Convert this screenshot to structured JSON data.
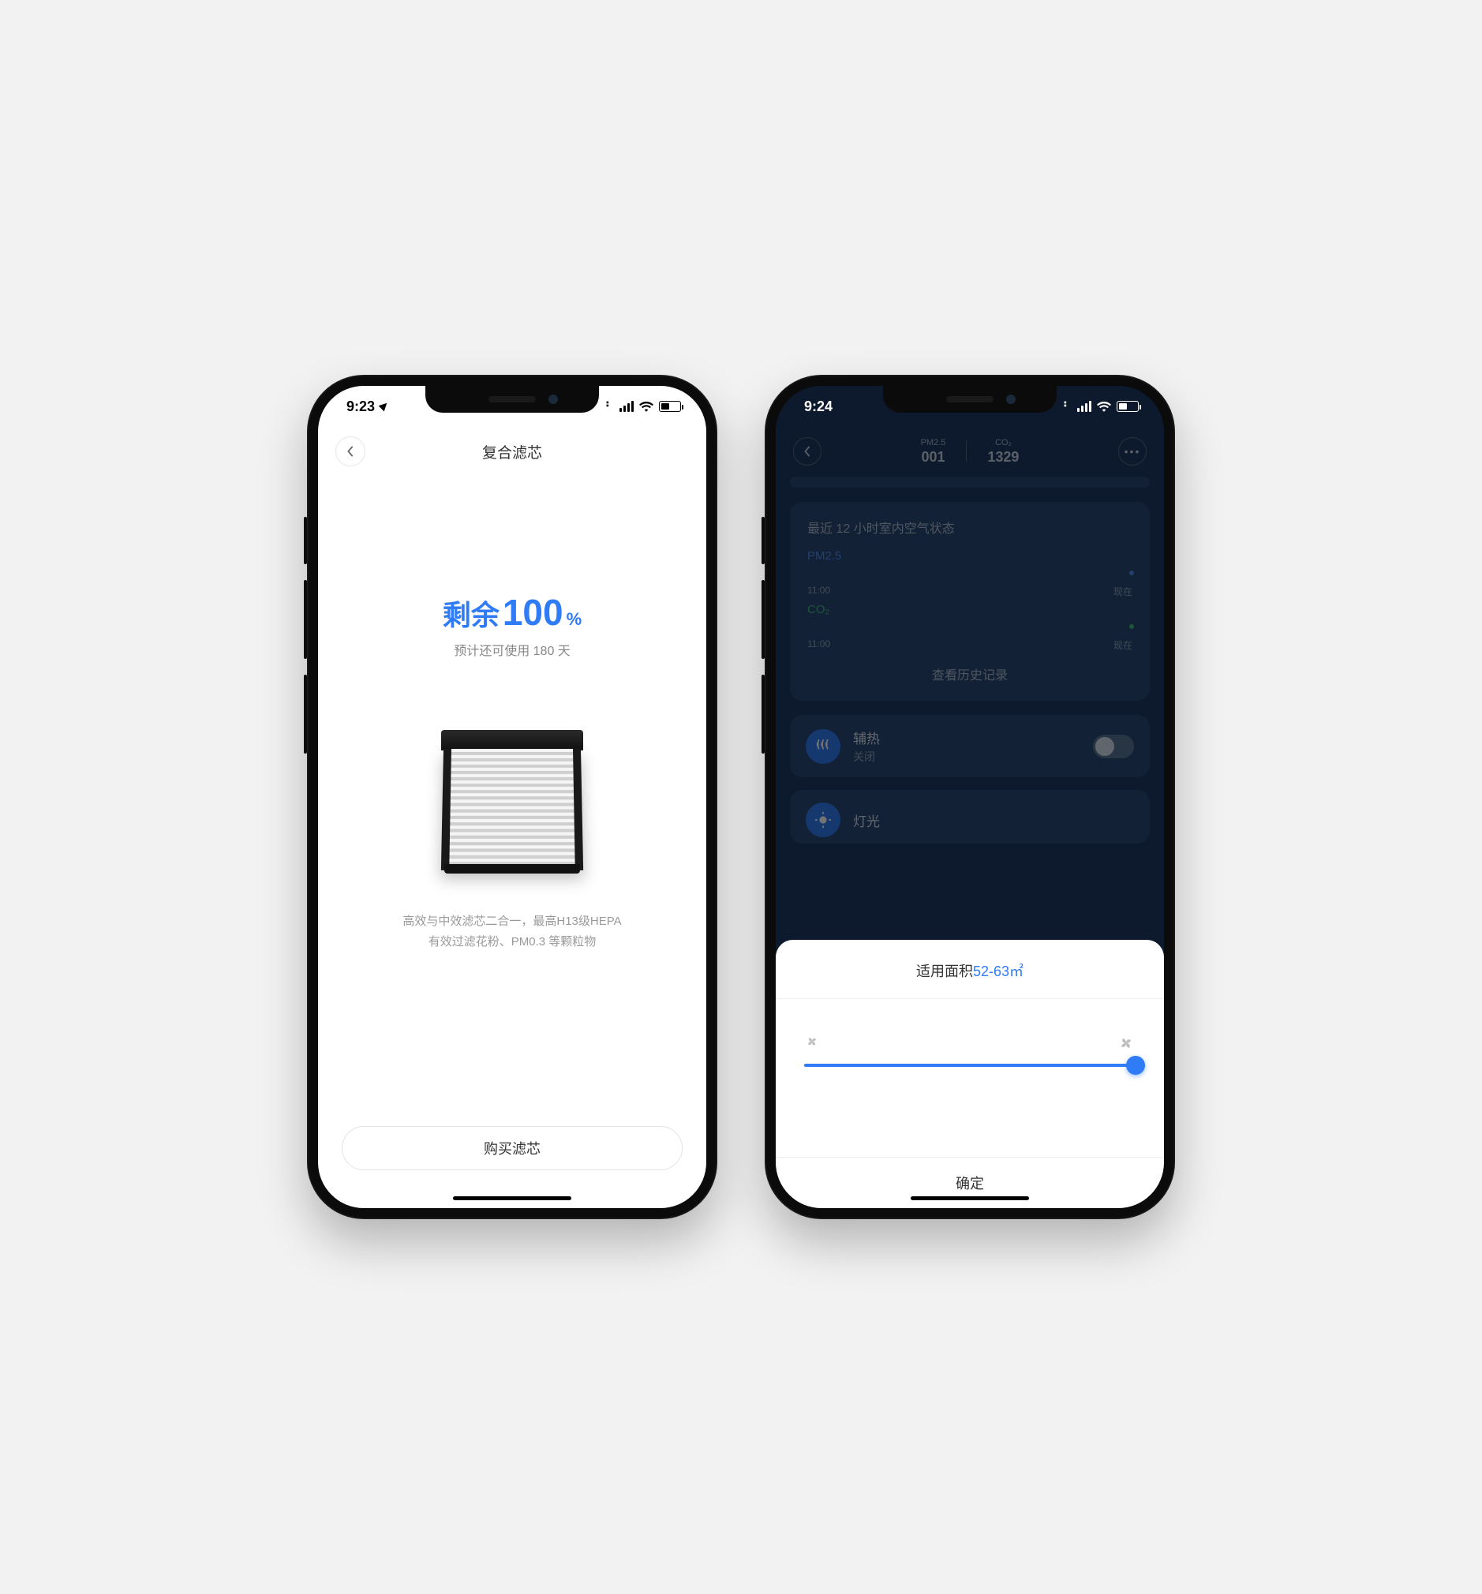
{
  "left": {
    "status": {
      "time": "9:23"
    },
    "header": {
      "title": "复合滤芯"
    },
    "remaining": {
      "label": "剩余",
      "value": "100",
      "percent_symbol": "%",
      "subtitle": "预计还可使用 180 天"
    },
    "desc": {
      "line1": "高效与中效滤芯二合一，最高H13级HEPA",
      "line2": "有效过滤花粉、PM0.3 等颗粒物"
    },
    "buy_button": "购买滤芯"
  },
  "right": {
    "status": {
      "time": "9:24"
    },
    "metrics": {
      "pm25_label": "PM2.5",
      "pm25_value": "001",
      "co2_label": "CO₂",
      "co2_value": "1329"
    },
    "card": {
      "title": "最近 12 小时室内空气状态",
      "series1_label": "PM2.5",
      "series2_label": "CO₂",
      "axis_start": "11:00",
      "axis_end": "现在",
      "history_link": "查看历史记录"
    },
    "row_heat": {
      "title": "辅热",
      "subtitle": "关闭"
    },
    "row_light": {
      "title": "灯光"
    },
    "sheet": {
      "title_prefix": "适用面积",
      "title_value": "52-63㎡",
      "confirm": "确定"
    }
  }
}
